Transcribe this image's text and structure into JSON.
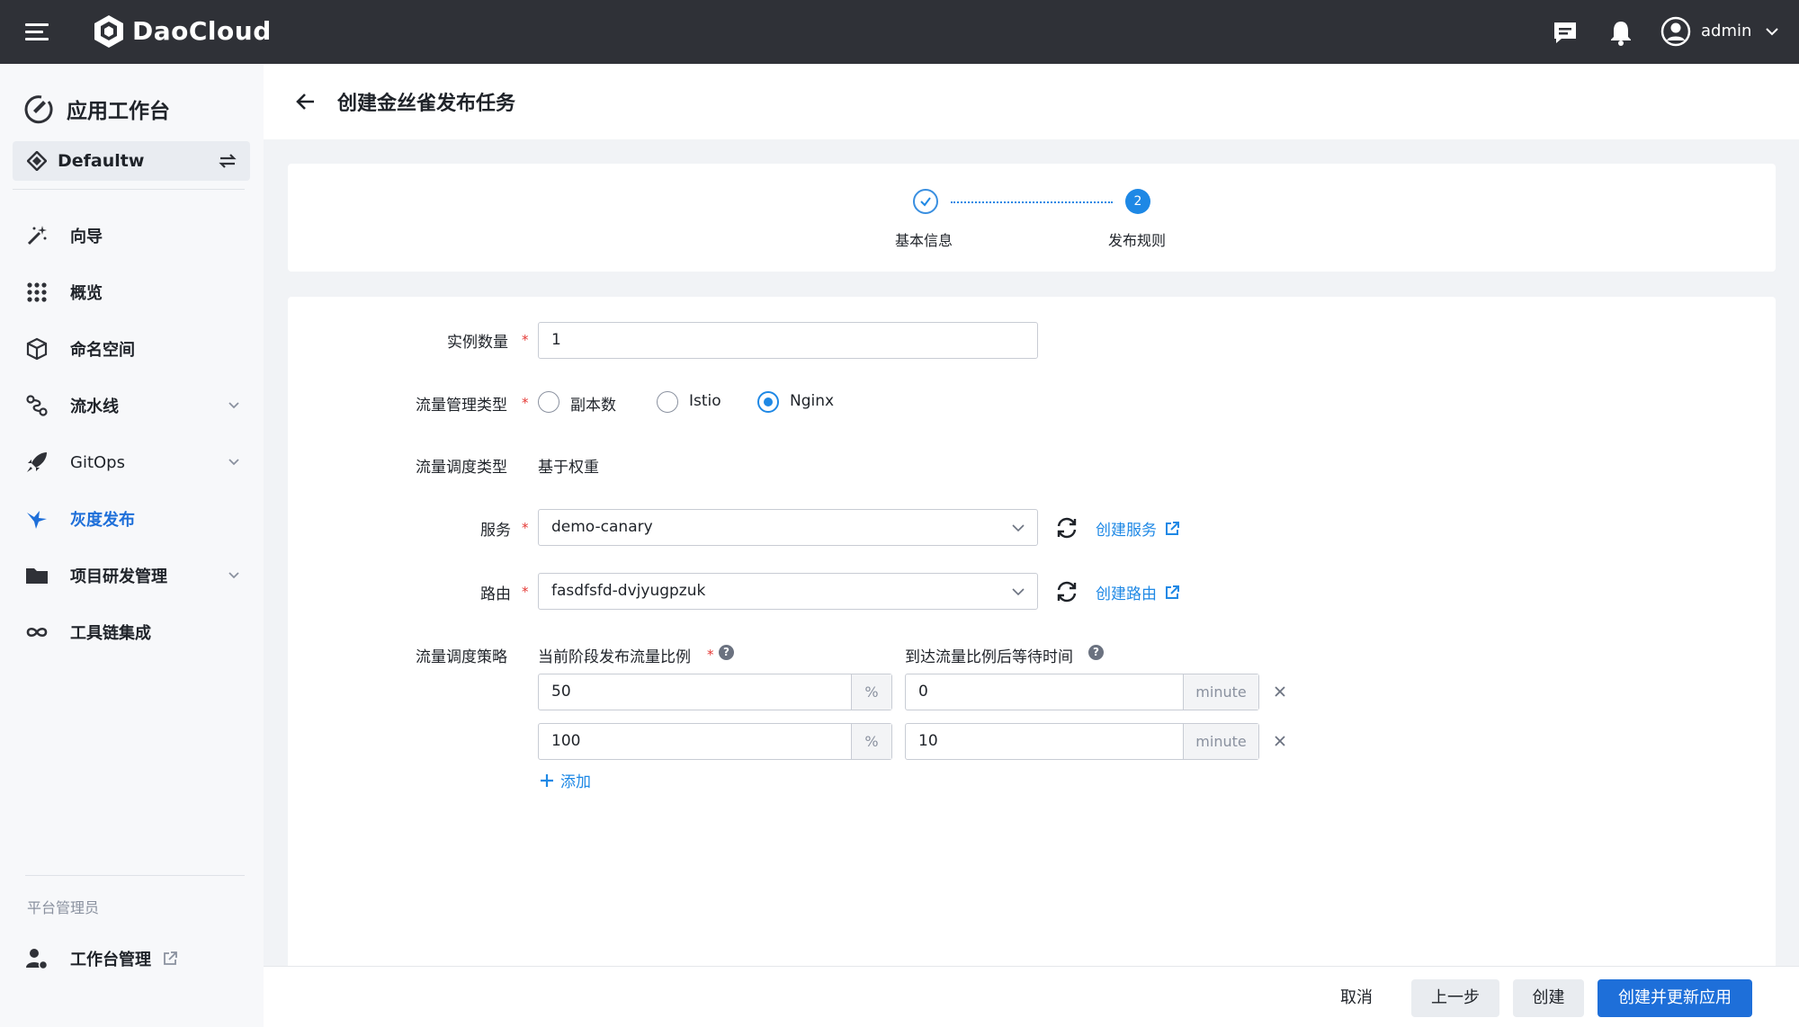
{
  "topbar": {
    "brand": "DaoCloud",
    "username": "admin",
    "icons": [
      "menu-icon",
      "daocloud-logo-icon",
      "message-icon",
      "bell-icon",
      "user-avatar-icon",
      "chevron-down-icon"
    ]
  },
  "sidebar": {
    "workbench_title": "应用工作台",
    "workspace_name": "Defaultw",
    "items": [
      {
        "label": "向导",
        "icon": "wand-icon"
      },
      {
        "label": "概览",
        "icon": "grid-icon"
      },
      {
        "label": "命名空间",
        "icon": "cube-icon"
      },
      {
        "label": "流水线",
        "icon": "pipeline-icon"
      },
      {
        "label": "GitOps",
        "icon": "rocket-icon"
      },
      {
        "label": "灰度发布",
        "icon": "bird-icon"
      },
      {
        "label": "项目研发管理",
        "icon": "folder-icon"
      },
      {
        "label": "工具链集成",
        "icon": "infinity-icon"
      }
    ],
    "section_label": "平台管理员",
    "admin_item": "工作台管理"
  },
  "header": {
    "title": "创建金丝雀发布任务"
  },
  "steps": [
    {
      "label": "基本信息",
      "state": "done"
    },
    {
      "label": "发布规则",
      "number": "2",
      "state": "active"
    }
  ],
  "form": {
    "instances_label": "实例数量",
    "instances_value": "1",
    "traffic_type_label": "流量管理类型",
    "traffic_options": [
      "副本数",
      "Istio",
      "Nginx"
    ],
    "traffic_selected": "Nginx",
    "schedule_type_label": "流量调度类型",
    "schedule_type_value": "基于权重",
    "service_label": "服务",
    "service_value": "demo-canary",
    "create_service": "创建服务",
    "route_label": "路由",
    "route_value": "fasdfsfd-dvjyugpzuk",
    "create_route": "创建路由",
    "strategy_label": "流量调度策略",
    "ratio_header": "当前阶段发布流量比例",
    "wait_header": "到达流量比例后等待时间",
    "ratio_unit": "%",
    "wait_unit": "minute",
    "rows": [
      {
        "ratio": "50",
        "wait": "0"
      },
      {
        "ratio": "100",
        "wait": "10"
      }
    ],
    "add_label": "添加",
    "required_mark": "*",
    "help_mark": "?"
  },
  "footer": {
    "cancel": "取消",
    "prev": "上一步",
    "create": "创建",
    "create_update": "创建并更新应用"
  },
  "colors": {
    "topbar": "#2f3137",
    "primary": "#1e6fd9",
    "accent": "#1e88e5",
    "required": "#e53935"
  }
}
